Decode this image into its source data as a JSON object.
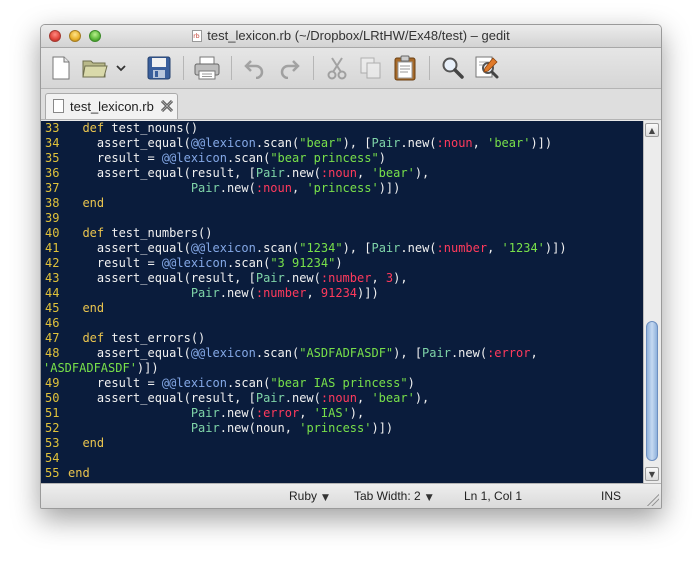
{
  "window": {
    "title": "test_lexicon.rb (~/Dropbox/LRtHW/Ex48/test) – gedit"
  },
  "toolbar": {
    "buttons": [
      {
        "name": "new-document",
        "icon": "document-new-icon"
      },
      {
        "name": "open",
        "icon": "folder-open-icon"
      },
      {
        "name": "open-recent",
        "icon": "chevron-down-icon"
      },
      {
        "name": "save",
        "icon": "floppy-disk-icon"
      },
      {
        "name": "print",
        "icon": "printer-icon"
      },
      {
        "name": "undo",
        "icon": "undo-icon"
      },
      {
        "name": "redo",
        "icon": "redo-icon"
      },
      {
        "name": "cut",
        "icon": "scissors-icon"
      },
      {
        "name": "copy",
        "icon": "copy-icon"
      },
      {
        "name": "paste",
        "icon": "clipboard-icon"
      },
      {
        "name": "find",
        "icon": "magnifier-icon"
      },
      {
        "name": "find-replace",
        "icon": "find-replace-icon"
      }
    ]
  },
  "tab": {
    "label": "test_lexicon.rb"
  },
  "editor": {
    "lines": [
      {
        "n": "33",
        "t": [
          [
            "k",
            "  def "
          ],
          [
            "f",
            "test_nouns()"
          ]
        ]
      },
      {
        "n": "34",
        "t": [
          [
            "f",
            "    assert_equal("
          ],
          [
            "ivar",
            "@@lexicon"
          ],
          [
            "f",
            ".scan("
          ],
          [
            "str",
            "\"bear\""
          ],
          [
            "f",
            "), ["
          ],
          [
            "cls",
            "Pair"
          ],
          [
            "f",
            ".new("
          ],
          [
            "sym",
            ":noun"
          ],
          [
            "f",
            ", "
          ],
          [
            "str",
            "'bear'"
          ],
          [
            "f",
            ")])"
          ]
        ]
      },
      {
        "n": "35",
        "t": [
          [
            "f",
            "    result = "
          ],
          [
            "ivar",
            "@@lexicon"
          ],
          [
            "f",
            ".scan("
          ],
          [
            "str",
            "\"bear princess\""
          ],
          [
            "f",
            ")"
          ]
        ]
      },
      {
        "n": "36",
        "t": [
          [
            "f",
            "    assert_equal(result, ["
          ],
          [
            "cls",
            "Pair"
          ],
          [
            "f",
            ".new("
          ],
          [
            "sym",
            ":noun"
          ],
          [
            "f",
            ", "
          ],
          [
            "str",
            "'bear'"
          ],
          [
            "f",
            "),"
          ]
        ]
      },
      {
        "n": "37",
        "t": [
          [
            "f",
            "                 "
          ],
          [
            "cls",
            "Pair"
          ],
          [
            "f",
            ".new("
          ],
          [
            "sym",
            ":noun"
          ],
          [
            "f",
            ", "
          ],
          [
            "str",
            "'princess'"
          ],
          [
            "f",
            ")])"
          ]
        ]
      },
      {
        "n": "38",
        "t": [
          [
            "k",
            "  end"
          ]
        ]
      },
      {
        "n": "39",
        "t": [
          [
            "f",
            ""
          ]
        ]
      },
      {
        "n": "40",
        "t": [
          [
            "k",
            "  def "
          ],
          [
            "f",
            "test_numbers()"
          ]
        ]
      },
      {
        "n": "41",
        "t": [
          [
            "f",
            "    assert_equal("
          ],
          [
            "ivar",
            "@@lexicon"
          ],
          [
            "f",
            ".scan("
          ],
          [
            "str",
            "\"1234\""
          ],
          [
            "f",
            "), ["
          ],
          [
            "cls",
            "Pair"
          ],
          [
            "f",
            ".new("
          ],
          [
            "sym",
            ":number"
          ],
          [
            "f",
            ", "
          ],
          [
            "str",
            "'1234'"
          ],
          [
            "f",
            ")])"
          ]
        ]
      },
      {
        "n": "42",
        "t": [
          [
            "f",
            "    result = "
          ],
          [
            "ivar",
            "@@lexicon"
          ],
          [
            "f",
            ".scan("
          ],
          [
            "str",
            "\"3 91234\""
          ],
          [
            "f",
            ")"
          ]
        ]
      },
      {
        "n": "43",
        "t": [
          [
            "f",
            "    assert_equal(result, ["
          ],
          [
            "cls",
            "Pair"
          ],
          [
            "f",
            ".new("
          ],
          [
            "sym",
            ":number"
          ],
          [
            "f",
            ", "
          ],
          [
            "sym",
            "3"
          ],
          [
            "f",
            "),"
          ]
        ]
      },
      {
        "n": "44",
        "t": [
          [
            "f",
            "                 "
          ],
          [
            "cls",
            "Pair"
          ],
          [
            "f",
            ".new("
          ],
          [
            "sym",
            ":number"
          ],
          [
            "f",
            ", "
          ],
          [
            "sym",
            "91234"
          ],
          [
            "f",
            ")])"
          ]
        ]
      },
      {
        "n": "45",
        "t": [
          [
            "k",
            "  end"
          ]
        ]
      },
      {
        "n": "46",
        "t": [
          [
            "f",
            ""
          ]
        ]
      },
      {
        "n": "47",
        "t": [
          [
            "k",
            "  def "
          ],
          [
            "f",
            "test_errors()"
          ]
        ]
      },
      {
        "n": "48",
        "t": [
          [
            "f",
            "    assert_equal("
          ],
          [
            "ivar",
            "@@lexicon"
          ],
          [
            "f",
            ".scan("
          ],
          [
            "str",
            "\"ASDFADFASDF\""
          ],
          [
            "f",
            "), ["
          ],
          [
            "cls",
            "Pair"
          ],
          [
            "f",
            ".new("
          ],
          [
            "sym",
            ":error"
          ],
          [
            "f",
            ","
          ]
        ]
      },
      {
        "n": "",
        "t": [
          [
            "str",
            "'ASDFADFASDF'"
          ],
          [
            "f",
            ")])"
          ]
        ]
      },
      {
        "n": "49",
        "t": [
          [
            "f",
            "    result = "
          ],
          [
            "ivar",
            "@@lexicon"
          ],
          [
            "f",
            ".scan("
          ],
          [
            "str",
            "\"bear IAS princess\""
          ],
          [
            "f",
            ")"
          ]
        ]
      },
      {
        "n": "50",
        "t": [
          [
            "f",
            "    assert_equal(result, ["
          ],
          [
            "cls",
            "Pair"
          ],
          [
            "f",
            ".new("
          ],
          [
            "sym",
            ":noun"
          ],
          [
            "f",
            ", "
          ],
          [
            "str",
            "'bear'"
          ],
          [
            "f",
            "),"
          ]
        ]
      },
      {
        "n": "51",
        "t": [
          [
            "f",
            "                 "
          ],
          [
            "cls",
            "Pair"
          ],
          [
            "f",
            ".new("
          ],
          [
            "sym",
            ":error"
          ],
          [
            "f",
            ", "
          ],
          [
            "str",
            "'IAS'"
          ],
          [
            "f",
            "),"
          ]
        ]
      },
      {
        "n": "52",
        "t": [
          [
            "f",
            "                 "
          ],
          [
            "cls",
            "Pair"
          ],
          [
            "f",
            ".new(noun, "
          ],
          [
            "str",
            "'princess'"
          ],
          [
            "f",
            ")])"
          ]
        ]
      },
      {
        "n": "53",
        "t": [
          [
            "k",
            "  end"
          ]
        ]
      },
      {
        "n": "54",
        "t": [
          [
            "f",
            ""
          ]
        ]
      },
      {
        "n": "55",
        "t": [
          [
            "k",
            "end"
          ]
        ]
      }
    ]
  },
  "statusbar": {
    "language": "Ruby",
    "tab_width_label": "Tab Width:",
    "tab_width_value": "2",
    "position": "Ln 1, Col 1",
    "mode": "INS"
  },
  "colors": {
    "editor_bg": "#0a1c3c",
    "keyword": "#eac44e",
    "string": "#78e04a",
    "symbol": "#ff3a5c",
    "instance_var": "#84a8e6",
    "class": "#7fd4a8",
    "line_number": "#e0c23a"
  }
}
